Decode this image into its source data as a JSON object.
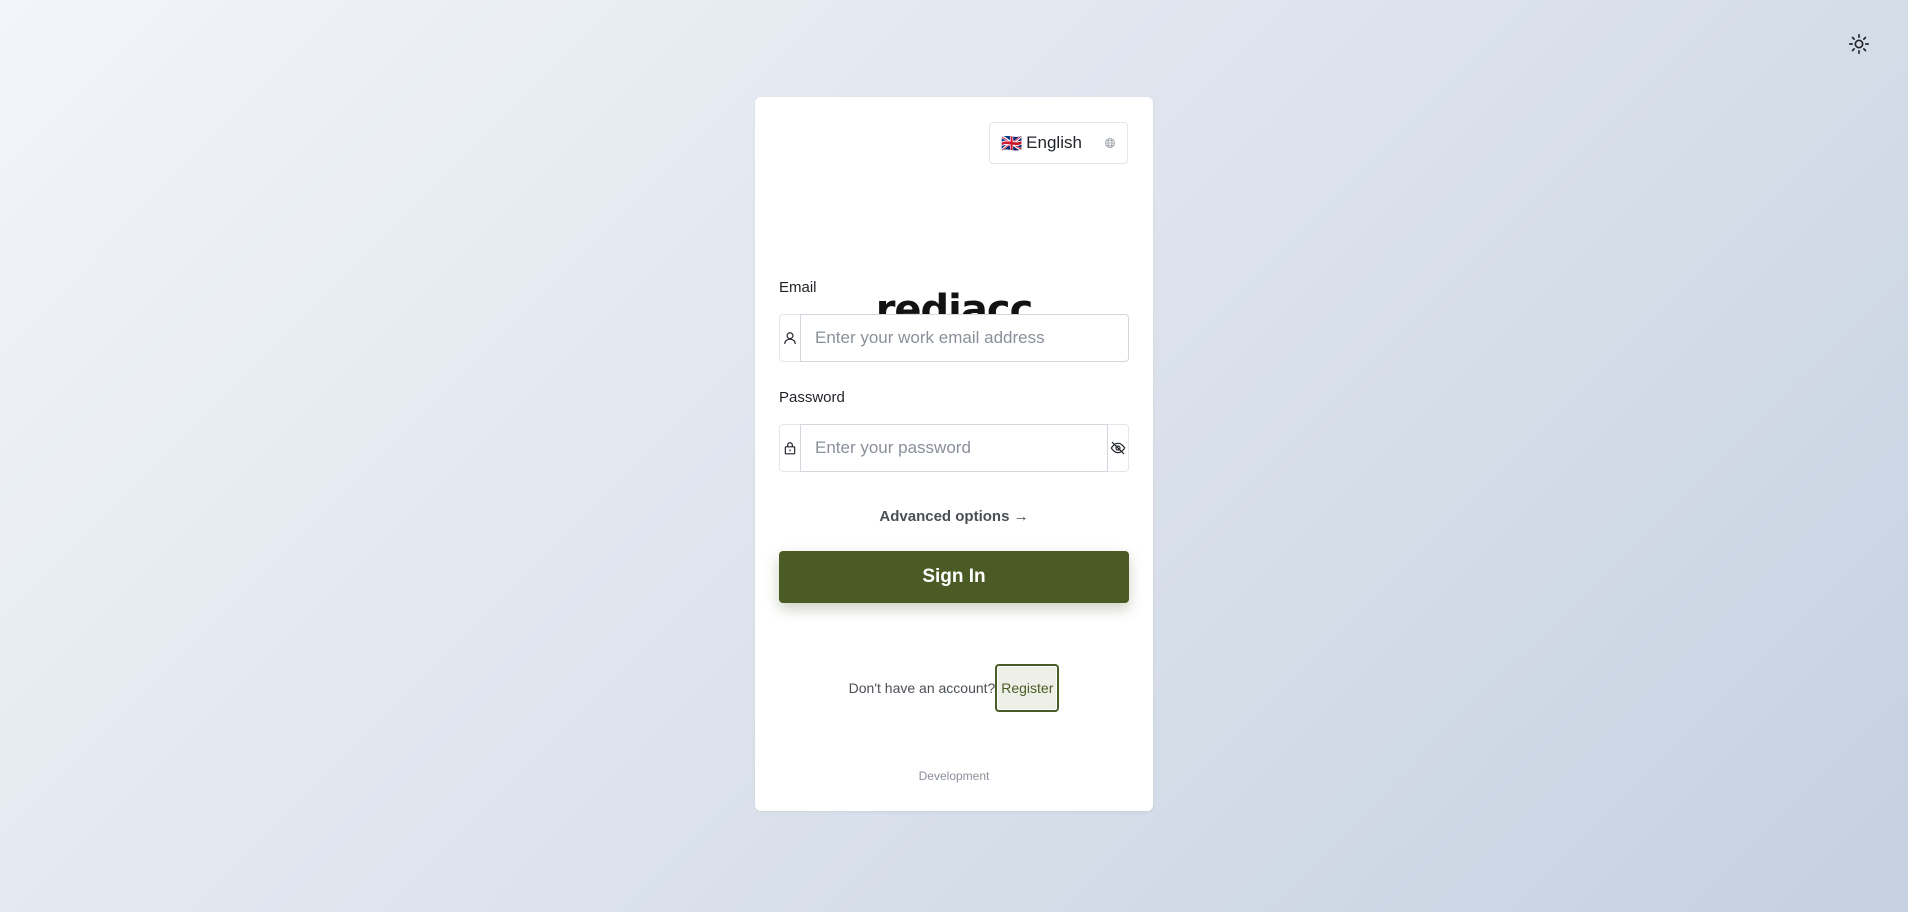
{
  "theme_toggle": {
    "icon": "sun-icon"
  },
  "language": {
    "flag": "🇬🇧",
    "label": "English",
    "caret_icon": "globe-icon"
  },
  "logo": {
    "text": "rediacc"
  },
  "email": {
    "label": "Email",
    "placeholder": "Enter your work email address",
    "value": "",
    "icon": "user-icon"
  },
  "password": {
    "label": "Password",
    "placeholder": "Enter your password",
    "value": "",
    "icon": "lock-icon",
    "toggle_icon": "eye-invisible-icon"
  },
  "advanced_options": {
    "label": "Advanced options →"
  },
  "sign_in": {
    "label": "Sign In"
  },
  "register": {
    "prompt": "Don't have an account?",
    "button_label": "Register"
  },
  "environment": {
    "label": "Development"
  },
  "colors": {
    "primary": "#4b5b26",
    "text": "#1f2328",
    "muted": "#8a9099"
  }
}
